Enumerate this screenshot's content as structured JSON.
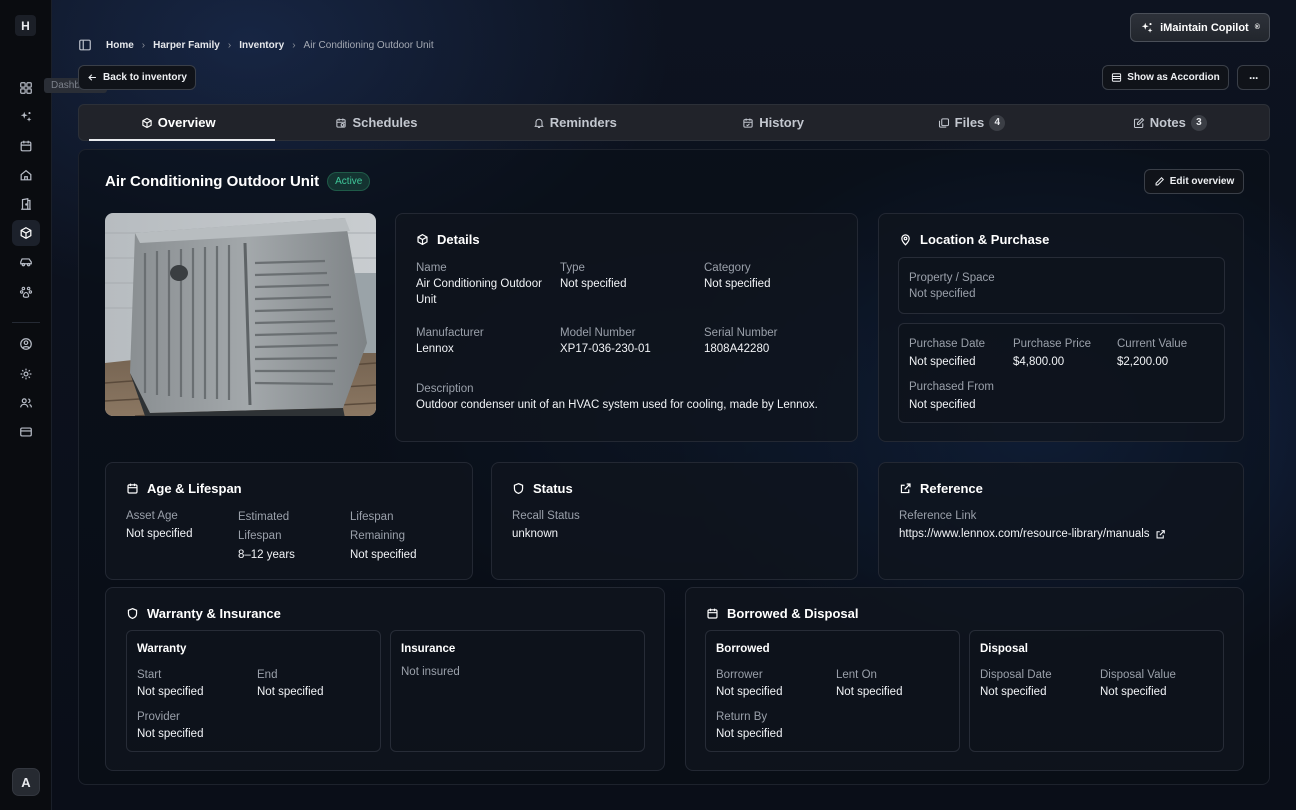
{
  "sidebar": {
    "logo": "H",
    "tooltip": "Dashboard",
    "items": [
      {
        "name": "dashboard",
        "icon": "grid-icon"
      },
      {
        "name": "copilot",
        "icon": "sparkles-icon"
      },
      {
        "name": "calendar",
        "icon": "calendar-icon"
      },
      {
        "name": "home",
        "icon": "home-icon"
      },
      {
        "name": "doors",
        "icon": "door-icon"
      },
      {
        "name": "inventory",
        "icon": "box-icon"
      },
      {
        "name": "vehicles",
        "icon": "car-icon"
      },
      {
        "name": "pets",
        "icon": "paw-icon"
      },
      {
        "name": "profile",
        "icon": "user-circle-icon"
      },
      {
        "name": "settings",
        "icon": "gear-icon"
      },
      {
        "name": "people",
        "icon": "users-icon"
      },
      {
        "name": "billing",
        "icon": "card-icon"
      }
    ],
    "avatar": "A"
  },
  "breadcrumb": {
    "home": "Home",
    "family": "Harper Family",
    "inventory": "Inventory",
    "current": "Air Conditioning Outdoor Unit"
  },
  "header": {
    "copilot_label": "iMaintain Copilot",
    "copilot_mark": "®",
    "back_label": "Back to inventory",
    "accordion_label": "Show as Accordion",
    "more_label": "···"
  },
  "tabs": [
    {
      "label": "Overview"
    },
    {
      "label": "Schedules"
    },
    {
      "label": "Reminders"
    },
    {
      "label": "History"
    },
    {
      "label": "Files",
      "count": "4"
    },
    {
      "label": "Notes",
      "count": "3"
    }
  ],
  "item": {
    "title": "Air Conditioning Outdoor Unit",
    "status": "Active",
    "edit_label": "Edit overview"
  },
  "details": {
    "title": "Details",
    "name_label": "Name",
    "name_value": "Air Conditioning Outdoor Unit",
    "type_label": "Type",
    "type_value": "Not specified",
    "category_label": "Category",
    "category_value": "Not specified",
    "manufacturer_label": "Manufacturer",
    "manufacturer_value": "Lennox",
    "model_label": "Model Number",
    "model_value": "XP17-036-230-01",
    "serial_label": "Serial Number",
    "serial_value": "1808A42280",
    "description_label": "Description",
    "description_value": "Outdoor condenser unit of an HVAC system used for cooling, made by Lennox."
  },
  "location": {
    "title": "Location & Purchase",
    "property_label": "Property / Space",
    "property_value": "Not specified",
    "purchase_date_label": "Purchase Date",
    "purchase_date_value": "Not specified",
    "purchase_price_label": "Purchase Price",
    "purchase_price_value": "$4,800.00",
    "current_value_label": "Current Value",
    "current_value_value": "$2,200.00",
    "purchased_from_label": "Purchased From",
    "purchased_from_value": "Not specified"
  },
  "age": {
    "title": "Age & Lifespan",
    "asset_age_label": "Asset Age",
    "asset_age_value": "Not specified",
    "est_label_1": "Estimated",
    "est_label_2": "Lifespan",
    "est_value": "8–12 years",
    "rem_label_1": "Lifespan",
    "rem_label_2": "Remaining",
    "rem_value": "Not specified"
  },
  "status": {
    "title": "Status",
    "recall_label": "Recall Status",
    "recall_value": "unknown"
  },
  "reference": {
    "title": "Reference",
    "link_label": "Reference Link",
    "link_value": "https://www.lennox.com/resource-library/manuals"
  },
  "warranty": {
    "title": "Warranty & Insurance",
    "warranty_title": "Warranty",
    "start_label": "Start",
    "start_value": "Not specified",
    "end_label": "End",
    "end_value": "Not specified",
    "provider_label": "Provider",
    "provider_value": "Not specified",
    "insurance_title": "Insurance",
    "insurance_value": "Not insured"
  },
  "borrowed": {
    "title": "Borrowed & Disposal",
    "borrowed_title": "Borrowed",
    "borrower_label": "Borrower",
    "borrower_value": "Not specified",
    "lent_label": "Lent On",
    "lent_value": "Not specified",
    "return_label": "Return By",
    "return_value": "Not specified",
    "disposal_title": "Disposal",
    "disposal_date_label": "Disposal Date",
    "disposal_date_value": "Not specified",
    "disposal_value_label": "Disposal Value",
    "disposal_value_value": "Not specified"
  },
  "colors": {
    "accent_green": "#3fc89a",
    "background": "#0b0f17",
    "card_border": "#232833"
  }
}
